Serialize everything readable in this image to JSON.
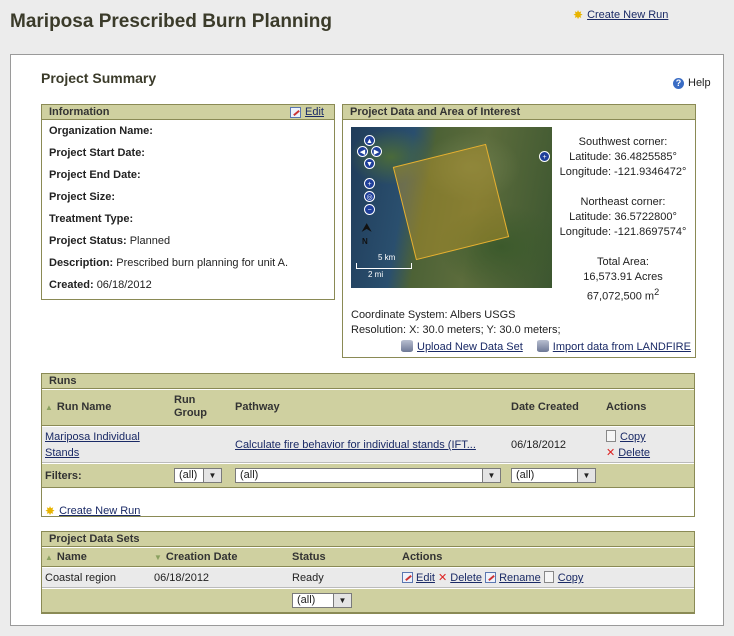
{
  "header": {
    "title": "Mariposa Prescribed Burn Planning",
    "create_new_run": "Create New Run"
  },
  "summary": {
    "title": "Project Summary",
    "help": "Help"
  },
  "information": {
    "heading": "Information",
    "edit": "Edit",
    "rows": [
      {
        "label": "Organization Name:",
        "value": ""
      },
      {
        "label": "Project Start Date:",
        "value": ""
      },
      {
        "label": "Project End Date:",
        "value": ""
      },
      {
        "label": "Project Size:",
        "value": ""
      },
      {
        "label": "Treatment Type:",
        "value": ""
      },
      {
        "label": "Project Status:",
        "value": "Planned"
      },
      {
        "label": "Description:",
        "value": "Prescribed burn planning for unit A."
      },
      {
        "label": "Created:",
        "value": "06/18/2012"
      }
    ]
  },
  "project_data": {
    "heading": "Project Data and Area of Interest",
    "map": {
      "scale_km": "5 km",
      "scale_mi": "2 mi",
      "north": "N"
    },
    "sw_corner": "Southwest corner:",
    "sw_lat": "Latitude: 36.4825585°",
    "sw_lon": "Longitude: -121.9346472°",
    "ne_corner": "Northeast corner:",
    "ne_lat": "Latitude: 36.5722800°",
    "ne_lon": "Longitude: -121.8697574°",
    "total_area": "Total Area:",
    "area_acres": "16,573.91 Acres",
    "area_m2_value": "67,072,500 m",
    "area_m2_sup": "2",
    "coordinate_system": "Coordinate System: Albers USGS",
    "resolution": "Resolution: X: 30.0 meters; Y: 30.0 meters;",
    "upload_link": "Upload New Data Set",
    "import_link": "Import data from LANDFIRE"
  },
  "runs": {
    "heading": "Runs",
    "columns": {
      "name": "Run Name",
      "group": "Run Group",
      "pathway": "Pathway",
      "date": "Date Created",
      "actions": "Actions"
    },
    "rows": [
      {
        "name_line1": "Mariposa Individual",
        "name_line2": "Stands",
        "group": "",
        "pathway": "Calculate fire behavior for individual stands (IFT...",
        "date": "06/18/2012",
        "copy": "Copy",
        "delete": "Delete"
      }
    ],
    "filters_label": "Filters:",
    "filter_group": "(all)",
    "filter_pathway": "(all)",
    "filter_date": "(all)",
    "create_new_run": "Create New Run"
  },
  "datasets": {
    "heading": "Project Data Sets",
    "columns": {
      "name": "Name",
      "date": "Creation Date",
      "status": "Status",
      "actions": "Actions"
    },
    "rows": [
      {
        "name": "Coastal region",
        "date": "06/18/2012",
        "status": "Ready",
        "edit": "Edit",
        "delete": "Delete",
        "rename": "Rename",
        "copy": "Copy"
      }
    ],
    "filter_status": "(all)"
  }
}
